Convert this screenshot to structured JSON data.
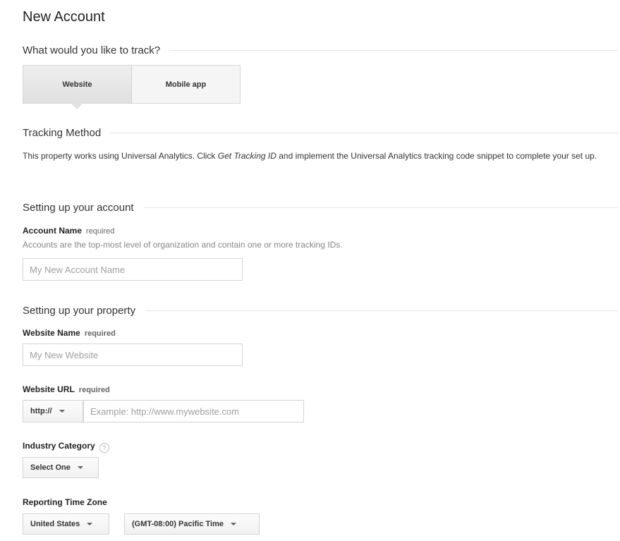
{
  "page": {
    "title": "New Account"
  },
  "track": {
    "heading": "What would you like to track?",
    "options": [
      {
        "label": "Website",
        "active": true
      },
      {
        "label": "Mobile app",
        "active": false
      }
    ]
  },
  "tracking_method": {
    "heading": "Tracking Method",
    "text_before": "This property works using Universal Analytics. Click ",
    "text_emphasis": "Get Tracking ID",
    "text_after": " and implement the Universal Analytics tracking code snippet to complete your set up."
  },
  "account": {
    "heading": "Setting up your account",
    "name_label": "Account Name",
    "required": "required",
    "hint": "Accounts are the top-most level of organization and contain one or more tracking IDs.",
    "name_placeholder": "My New Account Name",
    "name_value": ""
  },
  "property": {
    "heading": "Setting up your property",
    "website_name_label": "Website Name",
    "website_name_required": "required",
    "website_name_placeholder": "My New Website",
    "website_url_label": "Website URL",
    "website_url_required": "required",
    "protocol_selected": "http://",
    "url_placeholder": "Example: http://www.mywebsite.com",
    "industry_label": "Industry Category",
    "industry_help": "?",
    "industry_selected": "Select One",
    "timezone_label": "Reporting Time Zone",
    "country_selected": "United States",
    "timezone_selected": "(GMT-08:00) Pacific Time"
  }
}
